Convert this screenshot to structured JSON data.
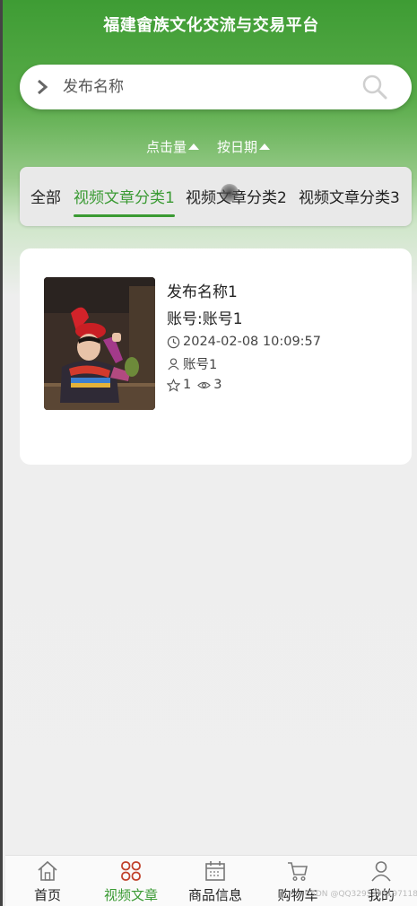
{
  "header": {
    "title": "福建畲族文化交流与交易平台"
  },
  "search": {
    "placeholder": "发布名称"
  },
  "sorts": [
    {
      "label": "点击量"
    },
    {
      "label": "按日期"
    }
  ],
  "tabs": [
    {
      "label": "全部"
    },
    {
      "label": "视频文章分类1",
      "active": true
    },
    {
      "label": "视频文章分类2"
    },
    {
      "label": "视频文章分类3"
    }
  ],
  "items": [
    {
      "name": "发布名称1",
      "account_line": "账号:账号1",
      "datetime": "2024-02-08 10:09:57",
      "user": "账号1",
      "stars": "1",
      "views": "3"
    }
  ],
  "bottom_nav": [
    {
      "label": "首页",
      "icon": "home-icon"
    },
    {
      "label": "视频文章",
      "icon": "clover-icon",
      "active": true
    },
    {
      "label": "商品信息",
      "icon": "calendar-icon"
    },
    {
      "label": "购物车",
      "icon": "cart-icon"
    },
    {
      "label": "我的",
      "icon": "user-icon"
    }
  ],
  "watermark": "CSDN @QQ3295391197118",
  "colors": {
    "accent": "#3a9a33",
    "header_green": "#3e9c34",
    "nav_active_icon": "#c0402a"
  }
}
